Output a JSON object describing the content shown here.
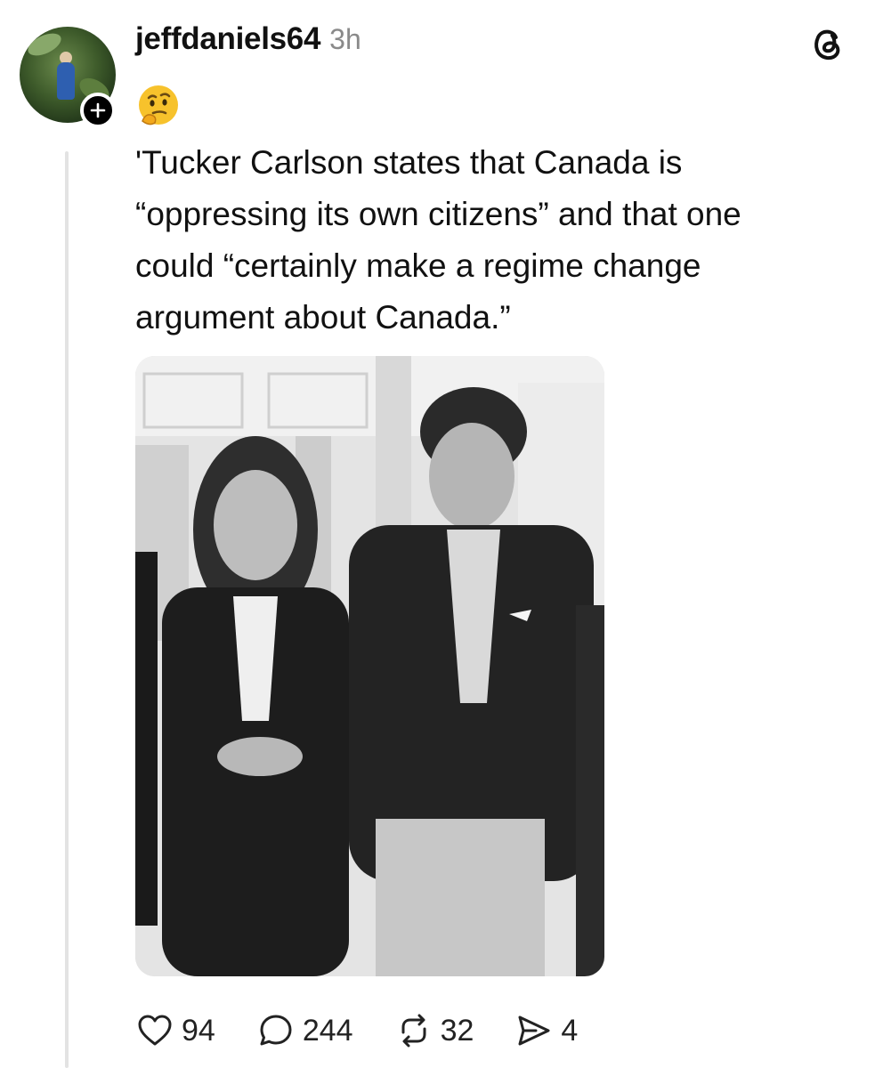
{
  "post": {
    "username": "jeffdaniels64",
    "time": "3h",
    "emoji": "🤔",
    "text": "'Tucker Carlson states that Canada is\n“oppressing its own citizens” and that one\ncould “certainly make a regime change\nargument about Canada.”"
  },
  "actions": {
    "likes": "94",
    "replies": "244",
    "reposts": "32",
    "shares": "4"
  },
  "icons": {
    "avatar": "avatar-photo",
    "follow": "plus-icon",
    "app": "threads-logo-icon",
    "like": "heart-icon",
    "reply": "comment-icon",
    "repost": "repost-icon",
    "share": "send-icon"
  },
  "colors": {
    "text": "#111111",
    "muted": "#8a8a8a",
    "thread_line": "#e3e3e3"
  }
}
